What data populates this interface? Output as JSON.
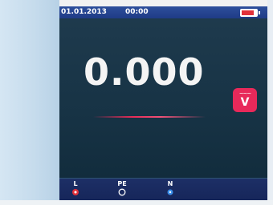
{
  "status_bar": {
    "date": "01.01.2013",
    "time": "00:00",
    "battery_level": 0.85
  },
  "display": {
    "reading": "0.000"
  },
  "unit_button": {
    "mode": "~~~",
    "unit": "V"
  },
  "terminals": [
    {
      "label": "L",
      "icon": "red-dot-icon"
    },
    {
      "label": "PE",
      "icon": "ring-icon"
    },
    {
      "label": "N",
      "icon": "blue-dot-icon"
    }
  ],
  "colors": {
    "accent": "#e8295a",
    "status_bar": "#2a4896",
    "terminal_l": "#e0303a",
    "terminal_n": "#3a8ee8"
  }
}
